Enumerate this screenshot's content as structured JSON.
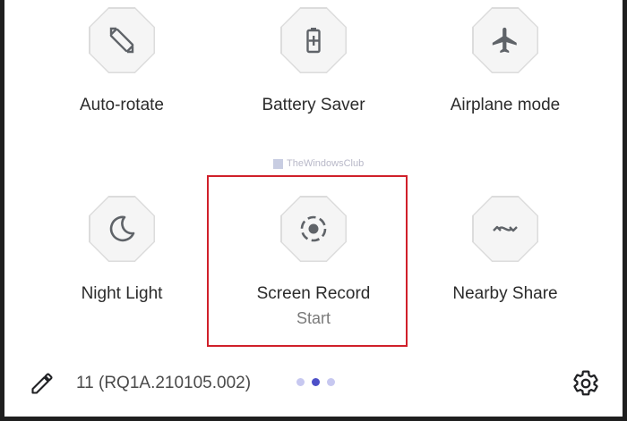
{
  "quick_settings": {
    "tiles": [
      {
        "label": "Auto-rotate",
        "icon": "auto-rotate-icon"
      },
      {
        "label": "Battery Saver",
        "icon": "battery-saver-icon"
      },
      {
        "label": "Airplane mode",
        "icon": "airplane-icon"
      },
      {
        "label": "Night Light",
        "icon": "moon-icon"
      },
      {
        "label": "Screen Record",
        "sublabel": "Start",
        "icon": "screen-record-icon"
      },
      {
        "label": "Nearby Share",
        "icon": "nearby-share-icon"
      }
    ],
    "page_indicator": {
      "pages": 3,
      "active": 2
    }
  },
  "watermark": "TheWindowsClub",
  "footer": {
    "build_number": "11 (RQ1A.210105.002)",
    "edit_icon": "pencil-icon",
    "settings_icon": "gear-icon"
  },
  "colors": {
    "highlight": "#d0202a",
    "tile_background": "#f5f5f5",
    "active_dot": "#4d50c8",
    "inactive_dot": "#c7c8f0"
  }
}
